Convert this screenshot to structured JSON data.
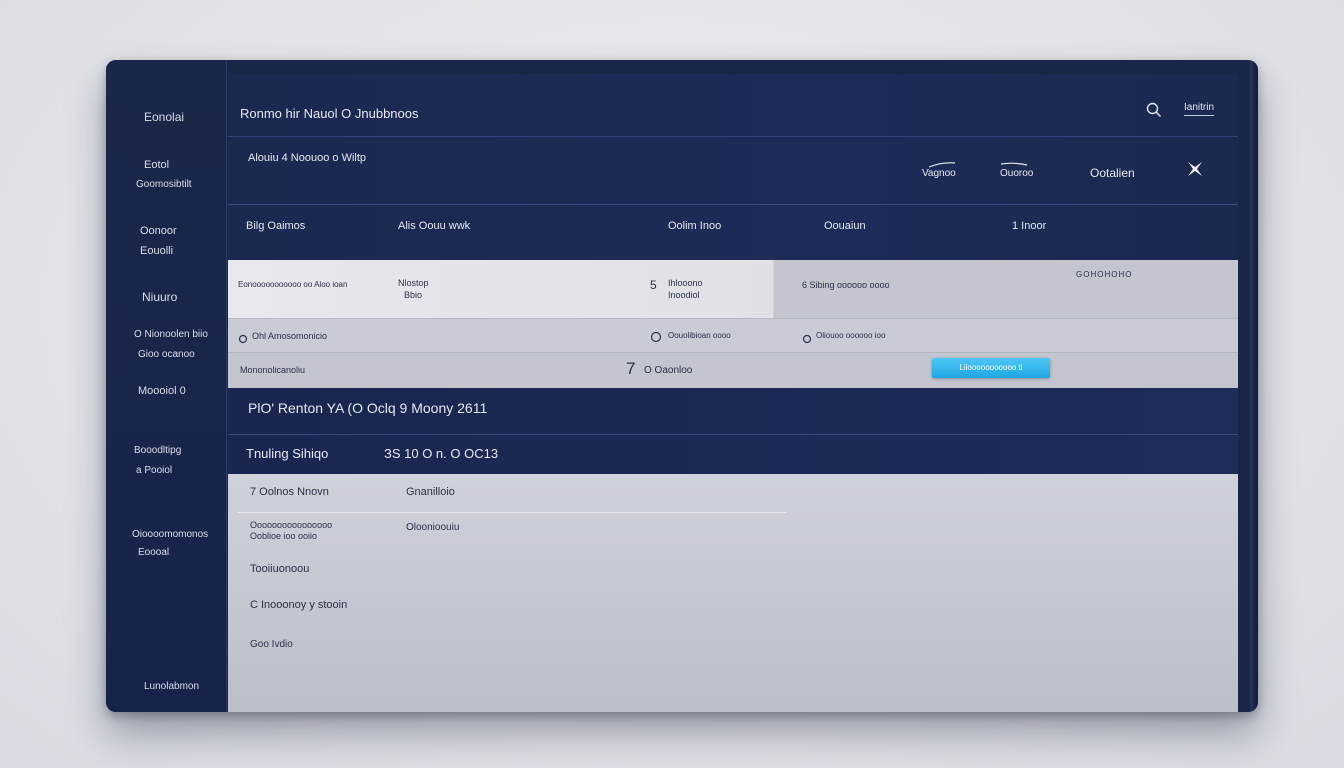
{
  "sidebar": {
    "items": [
      {
        "line1": "Eonolai",
        "line2": ""
      },
      {
        "line1": "Eotol",
        "line2": "Goomosibtilt"
      },
      {
        "line1": "Oonoor",
        "line2": "Eouolli"
      },
      {
        "line1": "Niuuro",
        "line2": ""
      },
      {
        "line1": "O Nionoolen biio",
        "line2": "Gioo ocanoo"
      },
      {
        "line1": "Moooiol 0",
        "line2": ""
      },
      {
        "line1": "Booodltipg",
        "line2": "a Pooiol"
      },
      {
        "line1": "Oioooomomonos",
        "line2": "Eoooal"
      }
    ],
    "footer": "Lunolabmon"
  },
  "header": {
    "title": "Ronmo hir Nauol O Jnubbnoos",
    "subtitle": "Alouiu 4 Noouoo o Wiltp",
    "top_right_link": "Ianitrin",
    "actions": [
      {
        "label": "Vagnoo"
      },
      {
        "label": "Ouoroo"
      },
      {
        "label": "Ootalien"
      }
    ]
  },
  "columns": [
    "Bilg Oaimos",
    "Alis Oouu wwk",
    "Oolim Inoo",
    "Oouaiun",
    "1 Inoor"
  ],
  "rows": [
    {
      "c1": "Eonooooooooooo oo Aloo ioan",
      "c2a": "Nlostop",
      "c2b": "Bbio",
      "c3a": "Ihlooono",
      "c3b": "Inoodiol",
      "c3num": "5",
      "c4": "6 Sibing oooooo oooo",
      "c5": "GOHOHOHO"
    },
    {
      "c1": "Ohl Amosomonicio",
      "c3": "Oouolibioan oooo",
      "c4": "Oliouoo oooooo ioo"
    },
    {
      "c1": "Mononolicanoliu",
      "c3num": "7",
      "c3": "O  Oaonloo",
      "button": "Liiooooooooooo  ti"
    }
  ],
  "band1": "PlO' Renton  YA  (O Oclq 9 Moony  2611",
  "band2": {
    "label": "Tnuling Sihiqo",
    "value": "ЗS 10 O n. O  OC13"
  },
  "lower": [
    {
      "left": "7 Oolnos Nnovn",
      "right": "Gnanilloio"
    },
    {
      "left": "Oooooooooooooooo",
      "left2": "Ooblioe   ioo ooiio",
      "right": "Oloonioouiu"
    },
    {
      "left": "Tooiiuonoou",
      "right": ""
    },
    {
      "left": "C Inooonoy y stooin",
      "right": ""
    },
    {
      "left": "Goo Ivdio",
      "right": ""
    }
  ],
  "colors": {
    "navy": "#1b2850",
    "accent": "#1fa6e3",
    "panel": "#c6c9d1"
  }
}
